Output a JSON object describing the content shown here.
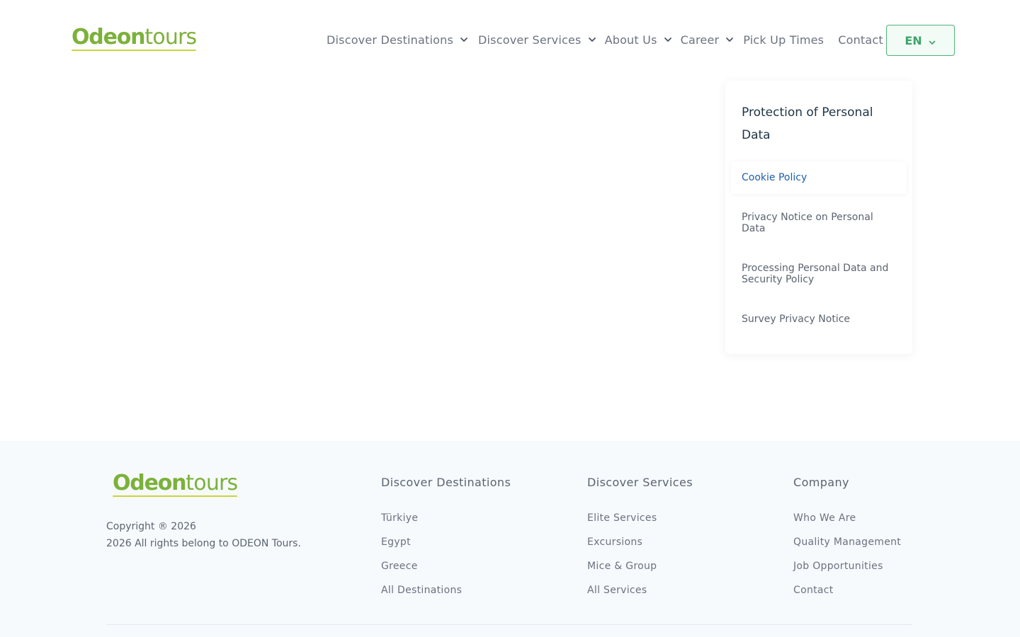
{
  "header": {
    "logo": {
      "odeon": "Odeon",
      "tours": "tours"
    },
    "nav": [
      {
        "label": "Discover Destinations",
        "has_dropdown": true
      },
      {
        "label": "Discover Services",
        "has_dropdown": true
      },
      {
        "label": "About Us",
        "has_dropdown": true
      },
      {
        "label": "Career",
        "has_dropdown": true
      },
      {
        "label": "Pick Up Times",
        "has_dropdown": false
      },
      {
        "label": "Contact",
        "has_dropdown": false
      }
    ],
    "language": {
      "code": "EN",
      "icon": "chevron-down-icon"
    }
  },
  "sidebar": {
    "title": "Protection of Personal Data",
    "links": [
      {
        "label": "Cookie Policy",
        "active": true
      },
      {
        "label": "Privacy Notice on Personal Data",
        "active": false
      },
      {
        "label": "Processing Personal Data and Security Policy",
        "active": false
      },
      {
        "label": "Survey Privacy Notice",
        "active": false
      }
    ]
  },
  "footer": {
    "logo": {
      "odeon": "Odeon",
      "tours": "tours"
    },
    "copyright_line1": "Copyright ® 2026",
    "copyright_line2": "2026 All rights belong to ODEON Tours.",
    "columns": [
      {
        "title": "Discover Destinations",
        "items": [
          "Türkiye",
          "Egypt",
          "Greece",
          "All Destinations"
        ]
      },
      {
        "title": "Discover Services",
        "items": [
          "Elite Services",
          "Excursions",
          "Mice & Group",
          "All Services"
        ]
      },
      {
        "title": "Company",
        "items": [
          "Who We Are",
          "Quality Management",
          "Job Opportunities",
          "Contact"
        ]
      }
    ]
  },
  "colors": {
    "brand_green": "#7cb13a",
    "logo_underline": "#c9d63b",
    "lang_border": "#4fb37c",
    "active_link": "#1f5fa8",
    "footer_bg": "#f6fafd"
  }
}
